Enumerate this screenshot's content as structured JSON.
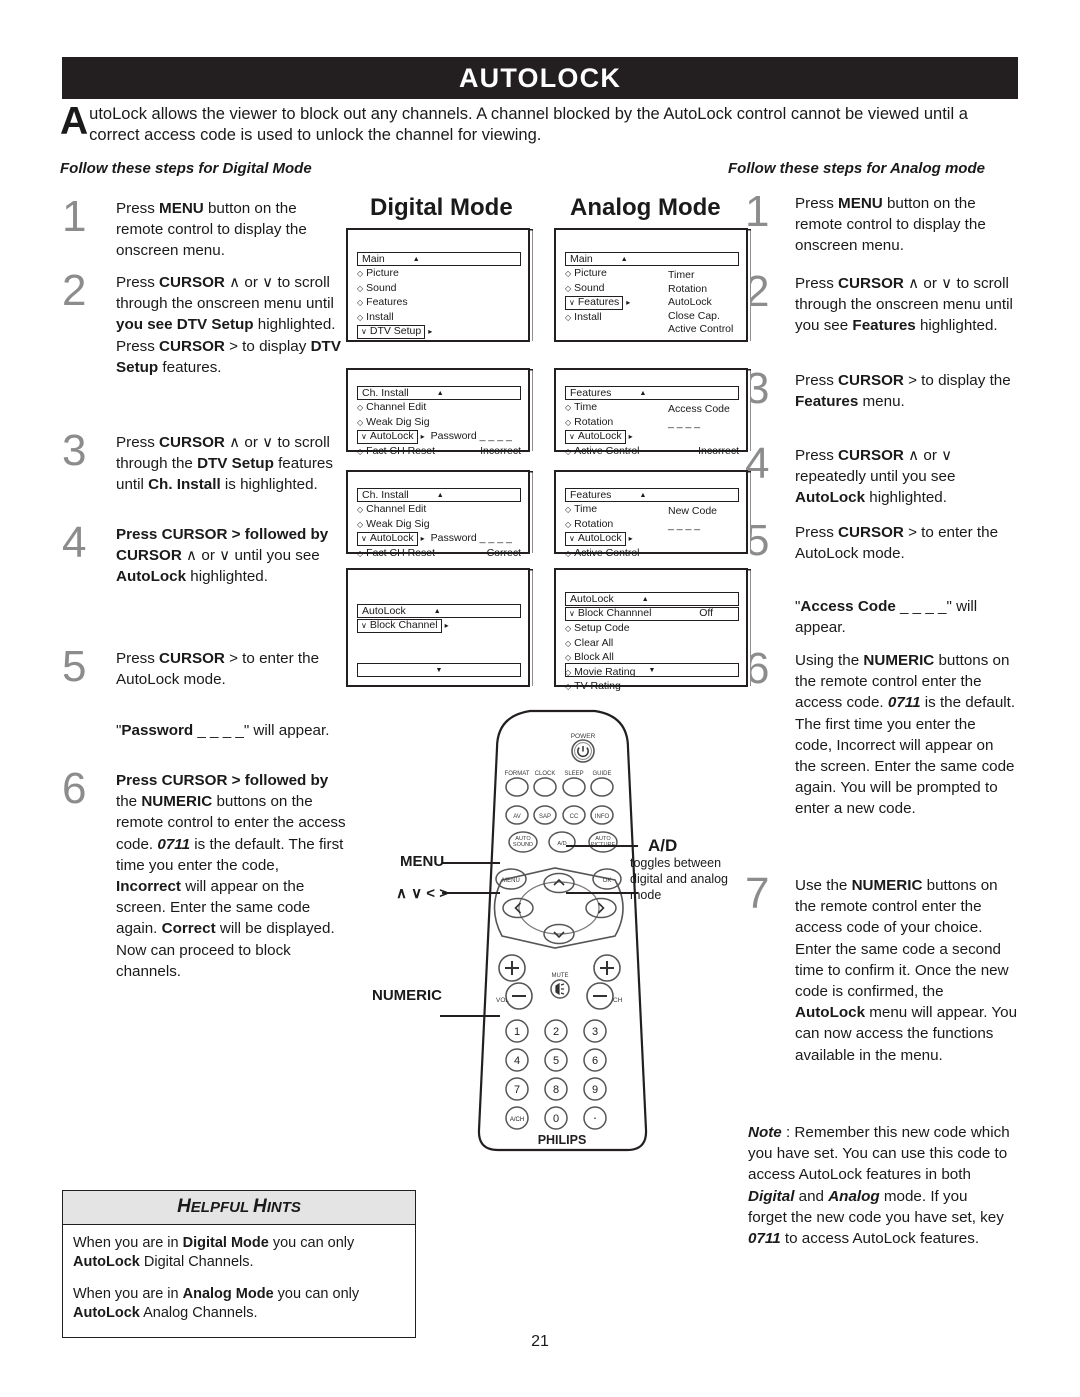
{
  "header": {
    "title": "AUTOLOCK",
    "intro_cap": "A",
    "intro_text": "utoLock allows the viewer to block out any channels.  A channel blocked by the AutoLock control cannot be viewed until a correct access code is used to unlock the channel for viewing.",
    "follow_left": "Follow these steps for Digital Mode",
    "follow_right": "Follow these steps for Analog mode"
  },
  "mode_headings": {
    "digital": "Digital Mode",
    "analog": "Analog Mode"
  },
  "digital_steps": [
    {
      "num": "1",
      "html": "Press <b>MENU</b> button on the remote control to display the onscreen menu."
    },
    {
      "num": "2",
      "html": "Press <b>CURSOR</b> &#8743;  or &#8744; to scroll through the onscreen menu until <b>you see DTV Setup</b> highlighted.  Press <b>CURSOR</b> &gt; to display <b>DTV Setup</b> features."
    },
    {
      "num": "3",
      "html": "Press <b>CURSOR</b> &#8743;  or &#8744; to scroll through the <b>DTV Setup</b> features until <b>Ch. Install</b> is highlighted."
    },
    {
      "num": "4",
      "html": "<b>Press CURSOR &gt; followed by CURSOR</b> &#8743;  or &#8744; until you see <b>AutoLock</b> highlighted."
    },
    {
      "num": "5",
      "html": "Press <b>CURSOR</b> &gt;  to enter the AutoLock mode."
    },
    {
      "num": "",
      "html": "\"<b>Password</b> _ _ _ _\" will appear."
    },
    {
      "num": "6",
      "html": "<b>Press CURSOR &gt; followed by</b> the <b>NUMERIC</b> buttons on the remote  control to enter the access code.   <i>0711</i> is the default.  The first time you enter the code, <b>Incorrect</b> will appear on the screen. Enter the same code again. <b>Correct</b> will be displayed.  Now can proceed to block channels."
    }
  ],
  "analog_steps": [
    {
      "num": "1",
      "html": "Press <b>MENU</b> button on the remote control to display the onscreen menu."
    },
    {
      "num": "2",
      "html": "Press <b>CURSOR</b>  &#8743;  or &#8744; to scroll through the onscreen menu until you see <b>Features</b> highlighted."
    },
    {
      "num": "3",
      "html": "Press <b>CURSOR</b>  &gt;  to display the <b>Features</b> menu."
    },
    {
      "num": "4",
      "html": "Press <b>CURSOR</b> &#8743;  or &#8744; repeatedly until you see <b>AutoLock</b> highlighted."
    },
    {
      "num": "5",
      "html": "Press <b>CURSOR</b> &gt;  to enter the AutoLock mode."
    },
    {
      "num": "",
      "html": "\"<b>Access Code</b> _ _ _ _\" will appear."
    },
    {
      "num": "6",
      "html": "Using the <b>NUMERIC</b> buttons on the remote control enter the access code.   <i>0711</i> is the default.  The first time you enter the code, Incorrect will appear on the screen. Enter the same code again. You will be prompted to enter a new code."
    },
    {
      "num": "7",
      "html": "Use the <b>NUMERIC</b> buttons on the remote control enter the access code of your choice. Enter the same code a second time to confirm it.   Once the new code is confirmed, the <b>AutoLock</b> menu will appear.  You can now access the functions available in the menu."
    }
  ],
  "note_html": "<b><i>Note</i></b> : Remember this new code which you have set. You can use this code to access AutoLock features in both <b><i>Digital</i></b> and <b><i>Analog</i></b> mode.  If you forget the new code you have set, key <b><i>0711</i></b> to access AutoLock features.",
  "digital_menus": [
    {
      "header": "Main",
      "items": [
        {
          "mark": "diamond",
          "label": "Picture"
        },
        {
          "mark": "diamond",
          "label": "Sound"
        },
        {
          "mark": "diamond",
          "label": "Features"
        },
        {
          "mark": "diamond",
          "label": "Install"
        },
        {
          "mark": "check",
          "label": "DTV Setup",
          "selected": true,
          "arrow": true
        }
      ],
      "col2": [],
      "footer_arrow": false
    },
    {
      "header": "Ch. Install",
      "items": [
        {
          "mark": "diamond",
          "label": "Channel Edit"
        },
        {
          "mark": "diamond",
          "label": "Weak Dig Sig"
        },
        {
          "mark": "check",
          "label": "AutoLock",
          "selected": true,
          "arrow": true,
          "right": "Password _ _ _ _"
        },
        {
          "mark": "diamond",
          "label": "Fact CH Reset",
          "right": "Incorrect"
        }
      ],
      "col2": [],
      "footer_arrow": false
    },
    {
      "header": "Ch. Install",
      "items": [
        {
          "mark": "diamond",
          "label": "Channel Edit"
        },
        {
          "mark": "diamond",
          "label": "Weak Dig Sig"
        },
        {
          "mark": "check",
          "label": "AutoLock",
          "selected": true,
          "arrow": true,
          "right": "Password _ _ _ _"
        },
        {
          "mark": "diamond",
          "label": "Fact CH Reset",
          "right": "Correct"
        }
      ],
      "col2": [],
      "footer_arrow": false
    },
    {
      "header": "AutoLock",
      "items": [
        {
          "mark": "check",
          "label": "Block Channel",
          "selected": true,
          "arrow": true
        }
      ],
      "col2": [],
      "footer_arrow": true
    }
  ],
  "analog_menus": [
    {
      "header": "Main",
      "items": [
        {
          "mark": "diamond",
          "label": "Picture"
        },
        {
          "mark": "diamond",
          "label": "Sound"
        },
        {
          "mark": "check",
          "label": "Features",
          "selected": true,
          "arrow": true
        },
        {
          "mark": "diamond",
          "label": "Install"
        }
      ],
      "col2": [
        "Timer",
        "Rotation",
        "AutoLock",
        "Close Cap.",
        "Active Control"
      ],
      "footer_arrow": false
    },
    {
      "header": "Features",
      "items": [
        {
          "mark": "diamond",
          "label": "Time"
        },
        {
          "mark": "diamond",
          "label": "Rotation"
        },
        {
          "mark": "check",
          "label": "AutoLock",
          "selected": true,
          "arrow": true
        },
        {
          "mark": "diamond",
          "label": "Active Control",
          "right": "Incorrect"
        }
      ],
      "col2": [
        "Access Code",
        "_ _ _ _"
      ],
      "footer_arrow": false
    },
    {
      "header": "Features",
      "items": [
        {
          "mark": "diamond",
          "label": "Time"
        },
        {
          "mark": "diamond",
          "label": "Rotation"
        },
        {
          "mark": "check",
          "label": "AutoLock",
          "selected": true,
          "arrow": true
        },
        {
          "mark": "diamond",
          "label": "Active Control"
        }
      ],
      "col2": [
        "New Code",
        "_ _ _ _"
      ],
      "footer_arrow": false
    },
    {
      "header": "AutoLock",
      "items": [
        {
          "mark": "check",
          "label": "Block Channnel",
          "selected": true,
          "barwide": true,
          "right": "Off"
        },
        {
          "mark": "diamond",
          "label": "Setup Code"
        },
        {
          "mark": "diamond",
          "label": "Clear All"
        },
        {
          "mark": "diamond",
          "label": "Block All"
        },
        {
          "mark": "diamond",
          "label": "Movie Rating"
        },
        {
          "mark": "diamond",
          "label": "TV Rating"
        }
      ],
      "col2": [],
      "footer_arrow": true
    }
  ],
  "remote": {
    "power_label": "POWER",
    "row1": [
      "FORMAT",
      "CLOCK",
      "SLEEP",
      "GUIDE"
    ],
    "row2": [
      "AV",
      "SAP",
      "CC",
      "INFO"
    ],
    "row3": [
      "AUTO SOUND",
      "A/D",
      "AUTO PICTURE"
    ],
    "menu_btn": "MENU",
    "ok_btn": "OK",
    "mute_label": "MUTE",
    "vol_label": "VOL",
    "ch_label": "CH",
    "numeric": [
      "1",
      "2",
      "3",
      "4",
      "5",
      "6",
      "7",
      "8",
      "9",
      "A/CH",
      "0",
      "·"
    ],
    "brand": "PHILIPS",
    "label_menu": "MENU",
    "label_cursor": "∧ ∨ < >",
    "label_numeric": "NUMERIC",
    "label_ad": "A/D",
    "callout_ad": "toggles between digital and analog mode"
  },
  "hints": {
    "title_a": "H",
    "title_b": "ELPFUL ",
    "title_c": "H",
    "title_d": "INTS",
    "p1_html": "When you are in <b>Digital Mode</b> you can only <b>AutoLock</b>  Digital Channels.",
    "p2_html": "When you are in <b>Analog Mode</b> you can only <b>AutoLock</b>  Analog Channels."
  },
  "page_number": "21"
}
